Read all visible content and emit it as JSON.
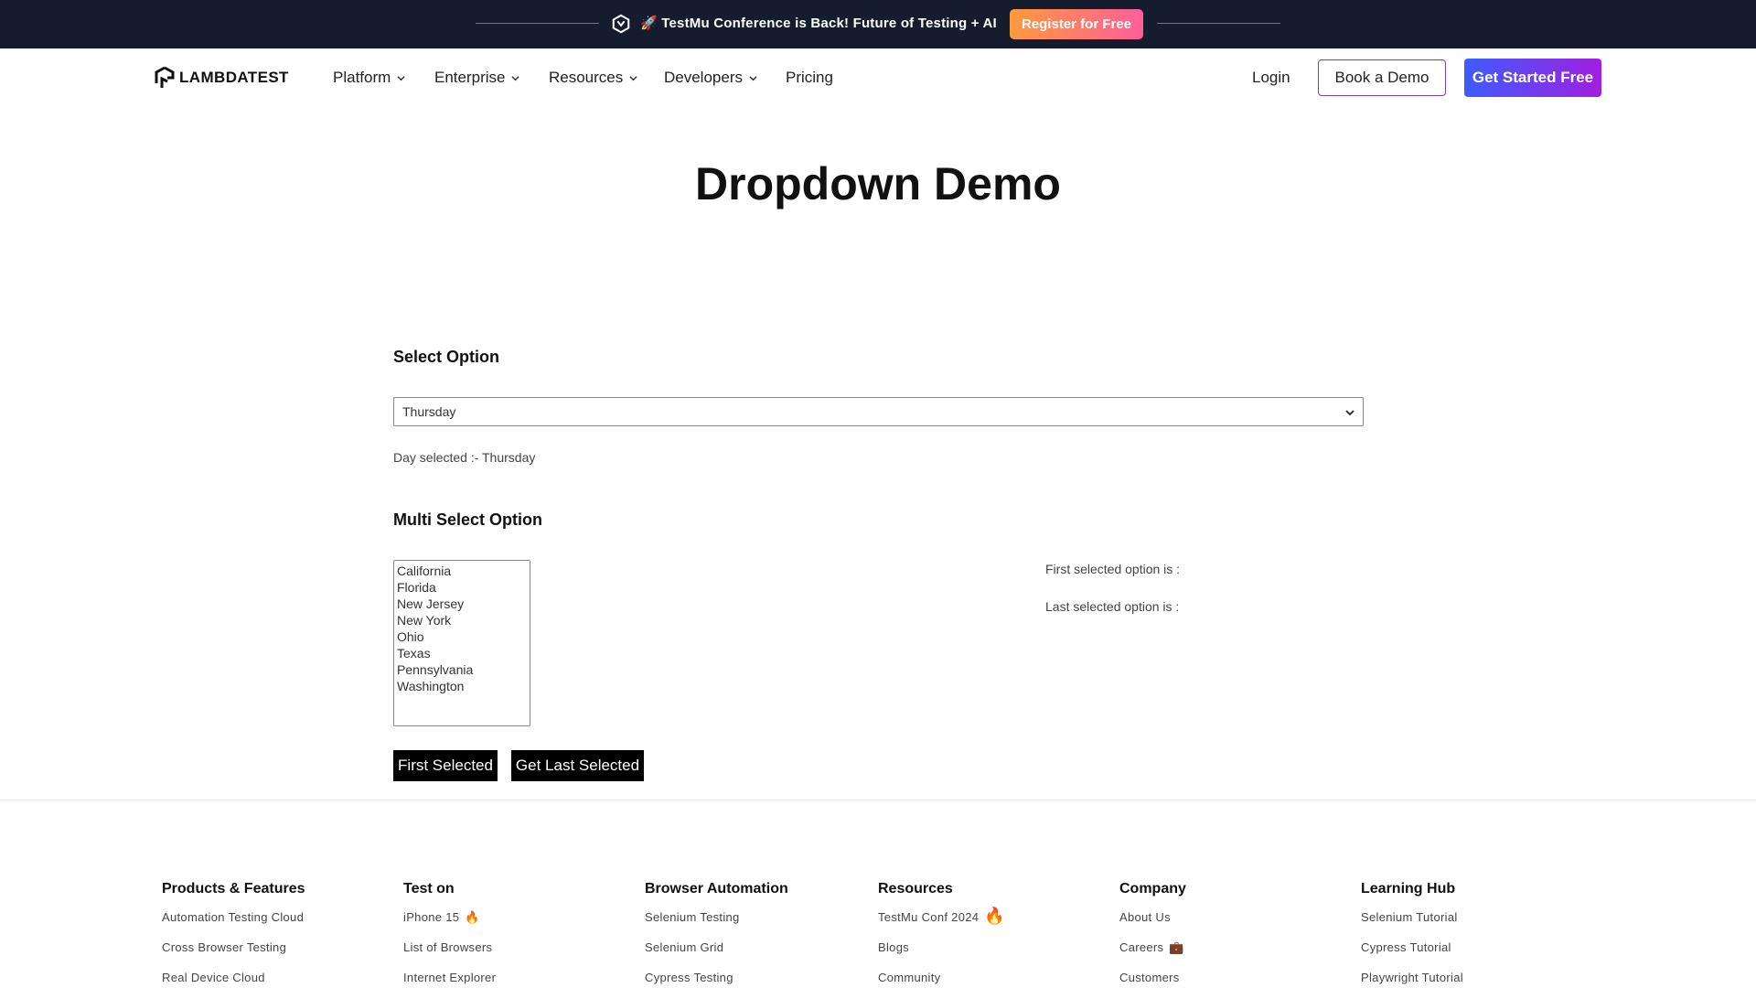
{
  "announcement": {
    "text": "🚀 TestMu Conference is Back! Future of Testing + AI",
    "register_label": "Register for Free"
  },
  "nav": {
    "brand": "LAMBDATEST",
    "menu": [
      {
        "label": "Platform",
        "has_dropdown": true
      },
      {
        "label": "Enterprise",
        "has_dropdown": true
      },
      {
        "label": "Resources",
        "has_dropdown": true
      },
      {
        "label": "Developers",
        "has_dropdown": true
      },
      {
        "label": "Pricing",
        "has_dropdown": false
      }
    ],
    "login": "Login",
    "book_demo": "Book a Demo",
    "get_started": "Get Started Free"
  },
  "main": {
    "title": "Dropdown Demo",
    "select_section_label": "Select Option",
    "select_value": "Thursday",
    "day_selected_text": "Day selected :- Thursday",
    "multi_section_label": "Multi Select Option",
    "multi_options": [
      "California",
      "Florida",
      "New Jersey",
      "New York",
      "Ohio",
      "Texas",
      "Pennsylvania",
      "Washington"
    ],
    "first_selected_label": "First selected option is :",
    "last_selected_label": "Last selected option is :",
    "first_selected_button": "First Selected",
    "last_selected_button": "Get Last Selected"
  },
  "footer": {
    "columns": [
      {
        "heading": "Products & Features",
        "links": [
          "Automation Testing Cloud",
          "Cross Browser Testing",
          "Real Device Cloud"
        ]
      },
      {
        "heading": "Test on",
        "links": [
          "iPhone 15",
          "List of Browsers",
          "Internet Explorer"
        ]
      },
      {
        "heading": "Browser Automation",
        "links": [
          "Selenium Testing",
          "Selenium Grid",
          "Cypress Testing"
        ]
      },
      {
        "heading": "Resources",
        "links": [
          "TestMu Conf 2024",
          "Blogs",
          "Community"
        ]
      },
      {
        "heading": "Company",
        "links": [
          "About Us",
          "Careers",
          "Customers"
        ]
      },
      {
        "heading": "Learning Hub",
        "links": [
          "Selenium Tutorial",
          "Cypress Tutorial",
          "Playwright Tutorial"
        ]
      }
    ]
  },
  "colors": {
    "announcement_bg": "#141c2e",
    "register_gradient": [
      "#ff9a3c",
      "#ff5e9a"
    ],
    "cta_gradient": [
      "#3d5cff",
      "#a11fe0"
    ],
    "book_demo_border": "#6b3fd6",
    "button_black": "#000000"
  }
}
